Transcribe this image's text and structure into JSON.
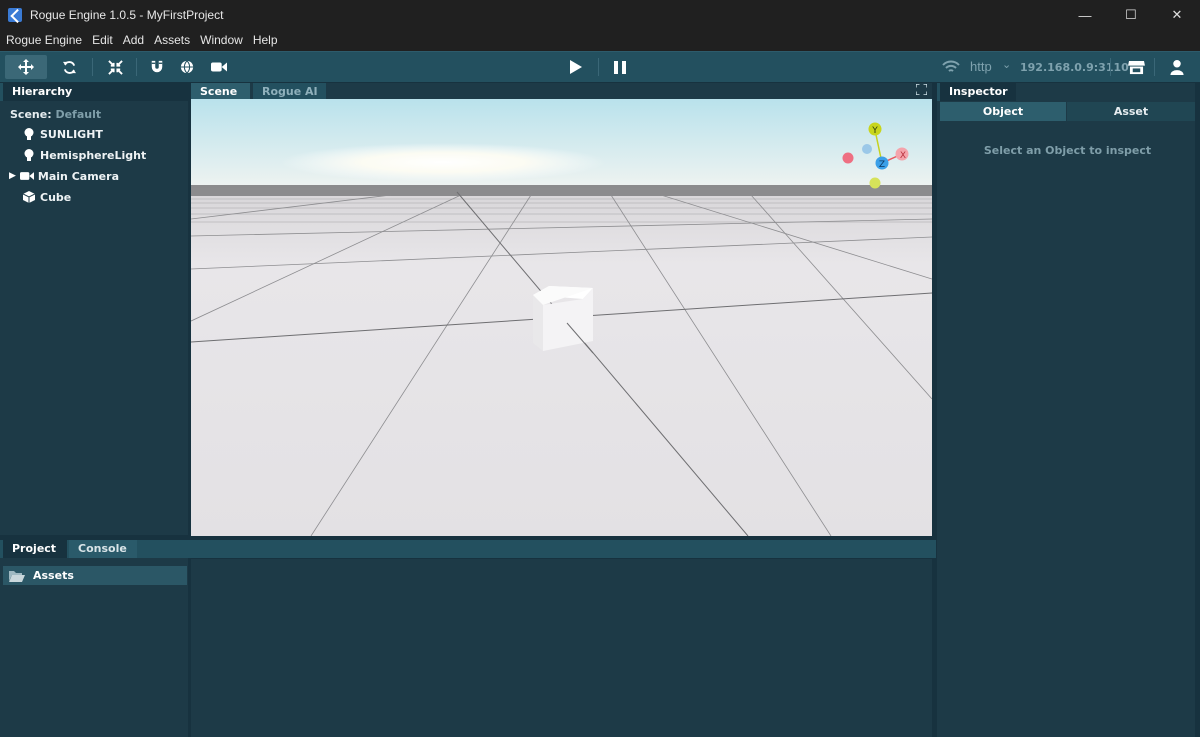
{
  "window": {
    "title": "Rogue Engine 1.0.5 - MyFirstProject",
    "controls": {
      "minimize": "—",
      "maximize": "☐",
      "close": "✕"
    }
  },
  "menu": [
    "Rogue Engine",
    "Edit",
    "Add",
    "Assets",
    "Window",
    "Help"
  ],
  "toolbar": {
    "tools": [
      "move-icon",
      "rotate-icon",
      "scale-icon",
      "magnet-icon",
      "globe-icon",
      "video-camera-icon"
    ],
    "playback": [
      "play-icon",
      "pause-icon"
    ],
    "connection": {
      "protocol": "http",
      "caret": "⌄",
      "address": "192.168.0.9:3110"
    },
    "right": [
      "store-icon",
      "user-icon"
    ]
  },
  "hierarchy": {
    "tab": "Hierarchy",
    "scene_label": "Scene:",
    "scene_name": "Default",
    "items": [
      {
        "label": "SUNLIGHT",
        "icon": "lightbulb-icon",
        "expandable": false
      },
      {
        "label": "HemisphereLight",
        "icon": "lightbulb-icon",
        "expandable": false
      },
      {
        "label": "Main Camera",
        "icon": "video-camera-icon",
        "expandable": true
      },
      {
        "label": "Cube",
        "icon": "cube-icon",
        "expandable": false
      }
    ]
  },
  "center_tabs": [
    "Scene",
    "Rogue AI"
  ],
  "gizmo": {
    "x": "X",
    "y": "Y",
    "z": "Z"
  },
  "inspector": {
    "tab": "Inspector",
    "subtabs": [
      "Object",
      "Asset"
    ],
    "empty_message": "Select an Object to inspect"
  },
  "bottom": {
    "tabs": [
      "Project",
      "Console"
    ],
    "folder": "Assets"
  },
  "colors": {
    "accent": "#23505f",
    "panel": "#1d3a47",
    "background": "#17323f"
  }
}
